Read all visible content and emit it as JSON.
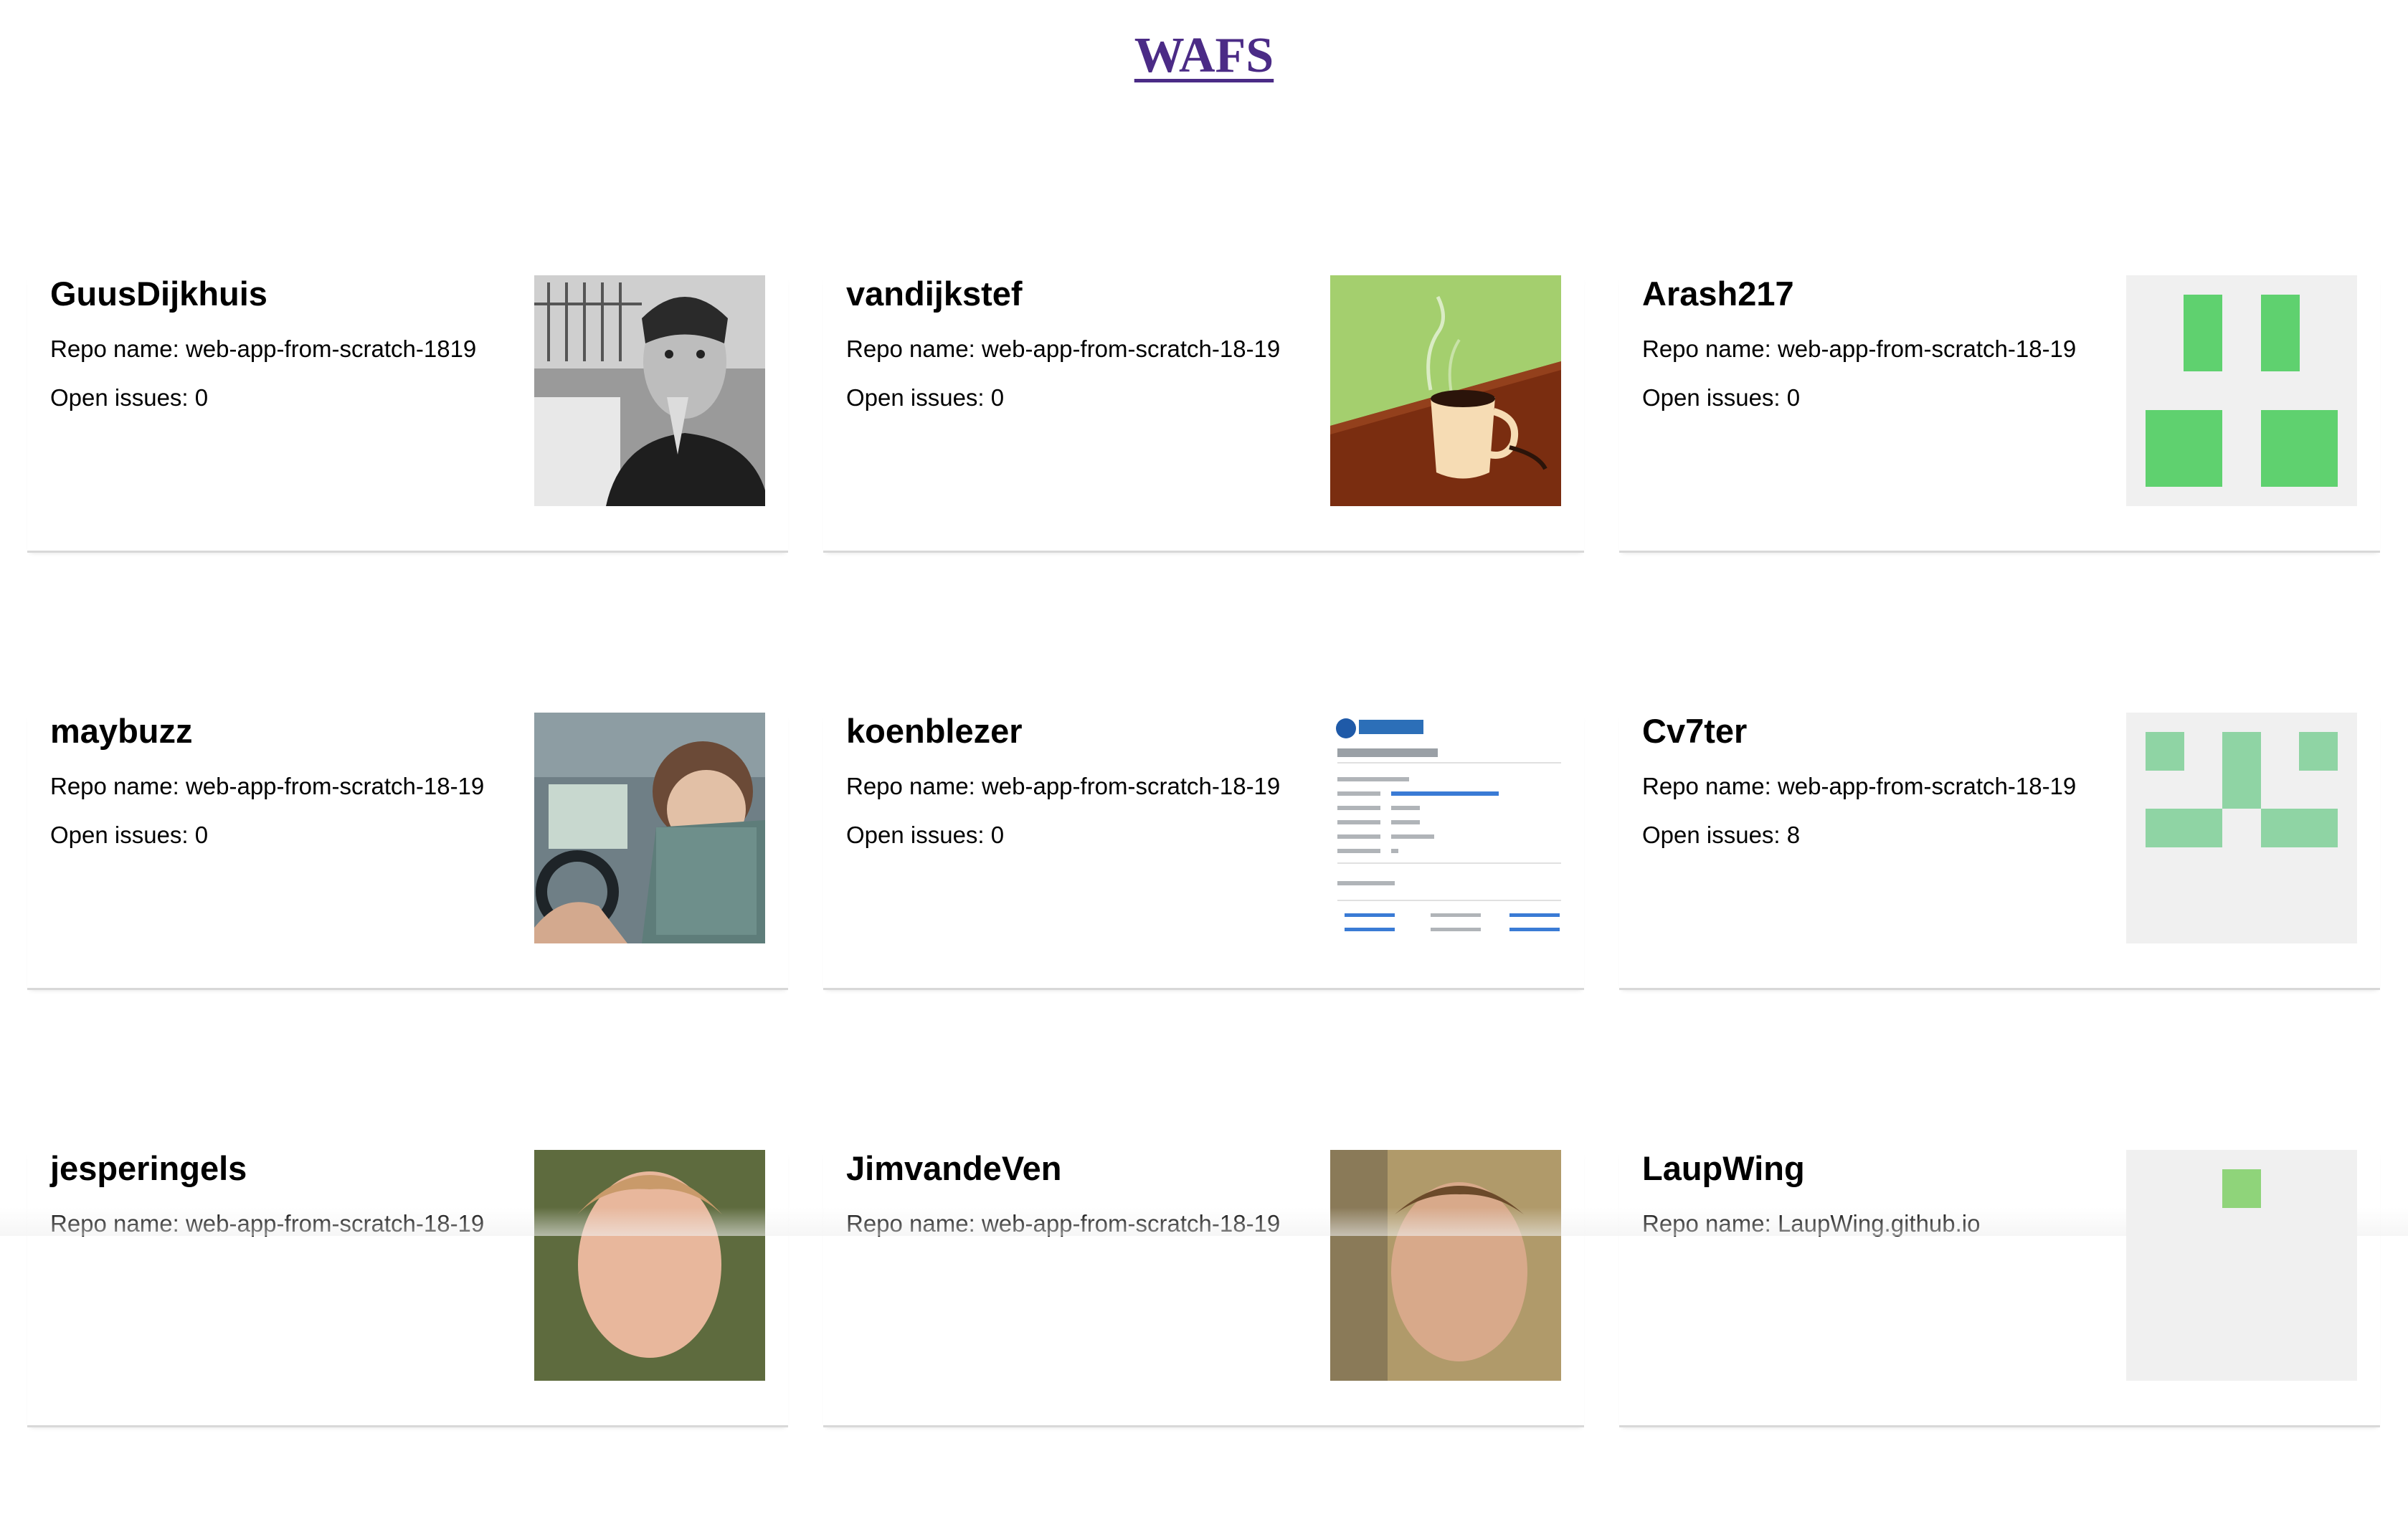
{
  "header": {
    "title": "WAFS"
  },
  "users": [
    {
      "username": "GuusDijkhuis",
      "repo_label": "Repo name: web-app-from-scratch-1819",
      "issues_label": "Open issues: 0",
      "avatar": "photo-man-bw"
    },
    {
      "username": "vandijkstef",
      "repo_label": "Repo name: web-app-from-scratch-18-19",
      "issues_label": "Open issues: 0",
      "avatar": "coffee-cup-illustration"
    },
    {
      "username": "Arash217",
      "repo_label": "Repo name: web-app-from-scratch-18-19",
      "issues_label": "Open issues: 0",
      "avatar": "identicon-green"
    },
    {
      "username": "maybuzz",
      "repo_label": "Repo name: web-app-from-scratch-18-19",
      "issues_label": "Open issues: 0",
      "avatar": "photo-woman-car"
    },
    {
      "username": "koenblezer",
      "repo_label": "Repo name: web-app-from-scratch-18-19",
      "issues_label": "Open issues: 0",
      "avatar": "etherscan-screenshot"
    },
    {
      "username": "Cv7ter",
      "repo_label": "Repo name: web-app-from-scratch-18-19",
      "issues_label": "Open issues: 8",
      "avatar": "identicon-lightgreen"
    },
    {
      "username": "jesperingels",
      "repo_label": "Repo name: web-app-from-scratch-18-19",
      "issues_label": "",
      "avatar": "photo-man-outdoor"
    },
    {
      "username": "JimvandeVen",
      "repo_label": "Repo name: web-app-from-scratch-18-19",
      "issues_label": "",
      "avatar": "photo-man-indoor"
    },
    {
      "username": "LaupWing",
      "repo_label": "Repo name: LaupWing.github.io",
      "issues_label": "",
      "avatar": "identicon-small"
    }
  ],
  "colors": {
    "title": "#4b2b86",
    "identicon_green": "#5fd16f",
    "identicon_lightgreen": "#8fd4a4",
    "identicon_bg": "#f0f0f0",
    "divider": "#d8d8d8"
  }
}
